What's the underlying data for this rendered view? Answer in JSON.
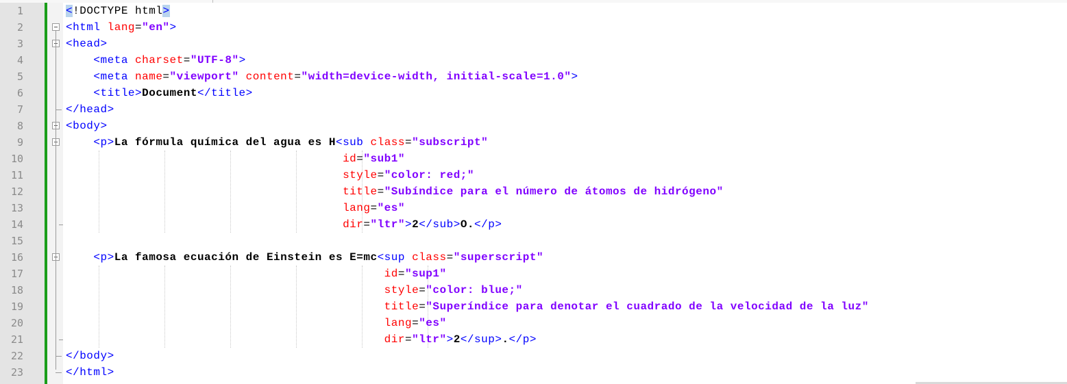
{
  "editor": {
    "lines": [
      {
        "n": "1",
        "tokens": [
          {
            "t": "<",
            "c": "bracket-hl"
          },
          {
            "t": "!DOCTYPE html",
            "c": "doctype"
          },
          {
            "t": ">",
            "c": "bracket-hl"
          }
        ]
      },
      {
        "n": "2",
        "tokens": [
          {
            "t": "<html ",
            "c": "tag"
          },
          {
            "t": "lang",
            "c": "attr"
          },
          {
            "t": "=",
            "c": "eq"
          },
          {
            "t": "\"en\"",
            "c": "val"
          },
          {
            "t": ">",
            "c": "tag"
          }
        ]
      },
      {
        "n": "3",
        "tokens": [
          {
            "t": "<head>",
            "c": "tag"
          }
        ]
      },
      {
        "n": "4",
        "tokens": [
          {
            "t": "    <meta ",
            "c": "tag"
          },
          {
            "t": "charset",
            "c": "attr"
          },
          {
            "t": "=",
            "c": "eq"
          },
          {
            "t": "\"UTF-8\"",
            "c": "val"
          },
          {
            "t": ">",
            "c": "tag"
          }
        ]
      },
      {
        "n": "5",
        "tokens": [
          {
            "t": "    <meta ",
            "c": "tag"
          },
          {
            "t": "name",
            "c": "attr"
          },
          {
            "t": "=",
            "c": "eq"
          },
          {
            "t": "\"viewport\"",
            "c": "val"
          },
          {
            "t": " ",
            "c": "eq"
          },
          {
            "t": "content",
            "c": "attr"
          },
          {
            "t": "=",
            "c": "eq"
          },
          {
            "t": "\"width=device-width, initial-scale=1.0\"",
            "c": "val"
          },
          {
            "t": ">",
            "c": "tag"
          }
        ]
      },
      {
        "n": "6",
        "tokens": [
          {
            "t": "    <title>",
            "c": "tag"
          },
          {
            "t": "Document",
            "c": "text"
          },
          {
            "t": "</title>",
            "c": "tag"
          }
        ]
      },
      {
        "n": "7",
        "tokens": [
          {
            "t": "</head>",
            "c": "tag"
          }
        ]
      },
      {
        "n": "8",
        "tokens": [
          {
            "t": "<body>",
            "c": "tag"
          }
        ]
      },
      {
        "n": "9",
        "tokens": [
          {
            "t": "    <p>",
            "c": "tag"
          },
          {
            "t": "La fórmula química del agua es H",
            "c": "text"
          },
          {
            "t": "<sub ",
            "c": "tag"
          },
          {
            "t": "class",
            "c": "attr"
          },
          {
            "t": "=",
            "c": "eq"
          },
          {
            "t": "\"subscript\"",
            "c": "val"
          }
        ]
      },
      {
        "n": "10",
        "tokens": [
          {
            "t": "                                        ",
            "c": "eq"
          },
          {
            "t": "id",
            "c": "attr"
          },
          {
            "t": "=",
            "c": "eq"
          },
          {
            "t": "\"sub1\"",
            "c": "val"
          }
        ]
      },
      {
        "n": "11",
        "tokens": [
          {
            "t": "                                        ",
            "c": "eq"
          },
          {
            "t": "style",
            "c": "attr"
          },
          {
            "t": "=",
            "c": "eq"
          },
          {
            "t": "\"color: red;\"",
            "c": "val"
          }
        ]
      },
      {
        "n": "12",
        "tokens": [
          {
            "t": "                                        ",
            "c": "eq"
          },
          {
            "t": "title",
            "c": "attr"
          },
          {
            "t": "=",
            "c": "eq"
          },
          {
            "t": "\"Subíndice para el número de átomos de hidrógeno\"",
            "c": "val"
          }
        ]
      },
      {
        "n": "13",
        "tokens": [
          {
            "t": "                                        ",
            "c": "eq"
          },
          {
            "t": "lang",
            "c": "attr"
          },
          {
            "t": "=",
            "c": "eq"
          },
          {
            "t": "\"es\"",
            "c": "val"
          }
        ]
      },
      {
        "n": "14",
        "tokens": [
          {
            "t": "                                        ",
            "c": "eq"
          },
          {
            "t": "dir",
            "c": "attr"
          },
          {
            "t": "=",
            "c": "eq"
          },
          {
            "t": "\"ltr\"",
            "c": "val"
          },
          {
            "t": ">",
            "c": "tag"
          },
          {
            "t": "2",
            "c": "text"
          },
          {
            "t": "</sub>",
            "c": "tag"
          },
          {
            "t": "O.",
            "c": "text"
          },
          {
            "t": "</p>",
            "c": "tag"
          }
        ]
      },
      {
        "n": "15",
        "tokens": []
      },
      {
        "n": "16",
        "tokens": [
          {
            "t": "    <p>",
            "c": "tag"
          },
          {
            "t": "La famosa ecuación de Einstein es E=mc",
            "c": "text"
          },
          {
            "t": "<sup ",
            "c": "tag"
          },
          {
            "t": "class",
            "c": "attr"
          },
          {
            "t": "=",
            "c": "eq"
          },
          {
            "t": "\"superscript\"",
            "c": "val"
          }
        ]
      },
      {
        "n": "17",
        "tokens": [
          {
            "t": "                                              ",
            "c": "eq"
          },
          {
            "t": "id",
            "c": "attr"
          },
          {
            "t": "=",
            "c": "eq"
          },
          {
            "t": "\"sup1\"",
            "c": "val"
          }
        ]
      },
      {
        "n": "18",
        "tokens": [
          {
            "t": "                                              ",
            "c": "eq"
          },
          {
            "t": "style",
            "c": "attr"
          },
          {
            "t": "=",
            "c": "eq"
          },
          {
            "t": "\"color: blue;\"",
            "c": "val"
          }
        ]
      },
      {
        "n": "19",
        "tokens": [
          {
            "t": "                                              ",
            "c": "eq"
          },
          {
            "t": "title",
            "c": "attr"
          },
          {
            "t": "=",
            "c": "eq"
          },
          {
            "t": "\"Superíndice para denotar el cuadrado de la velocidad de la luz\"",
            "c": "val"
          }
        ]
      },
      {
        "n": "20",
        "tokens": [
          {
            "t": "                                              ",
            "c": "eq"
          },
          {
            "t": "lang",
            "c": "attr"
          },
          {
            "t": "=",
            "c": "eq"
          },
          {
            "t": "\"es\"",
            "c": "val"
          }
        ]
      },
      {
        "n": "21",
        "tokens": [
          {
            "t": "                                              ",
            "c": "eq"
          },
          {
            "t": "dir",
            "c": "attr"
          },
          {
            "t": "=",
            "c": "eq"
          },
          {
            "t": "\"ltr\"",
            "c": "val"
          },
          {
            "t": ">",
            "c": "tag"
          },
          {
            "t": "2",
            "c": "text"
          },
          {
            "t": "</sup>",
            "c": "tag"
          },
          {
            "t": ".",
            "c": "text"
          },
          {
            "t": "</p>",
            "c": "tag"
          }
        ]
      },
      {
        "n": "22",
        "tokens": [
          {
            "t": "</body>",
            "c": "tag"
          }
        ]
      },
      {
        "n": "23",
        "tokens": [
          {
            "t": "</html>",
            "c": "tag"
          }
        ]
      }
    ]
  },
  "colors": {
    "gutter_bg": "#e4e4e4",
    "change_bar": "#1a9e1a",
    "tag": "#0000ff",
    "attribute": "#ff0000",
    "value": "#8000ff",
    "text": "#000000",
    "bracket_highlight": "#b9d4ee"
  }
}
